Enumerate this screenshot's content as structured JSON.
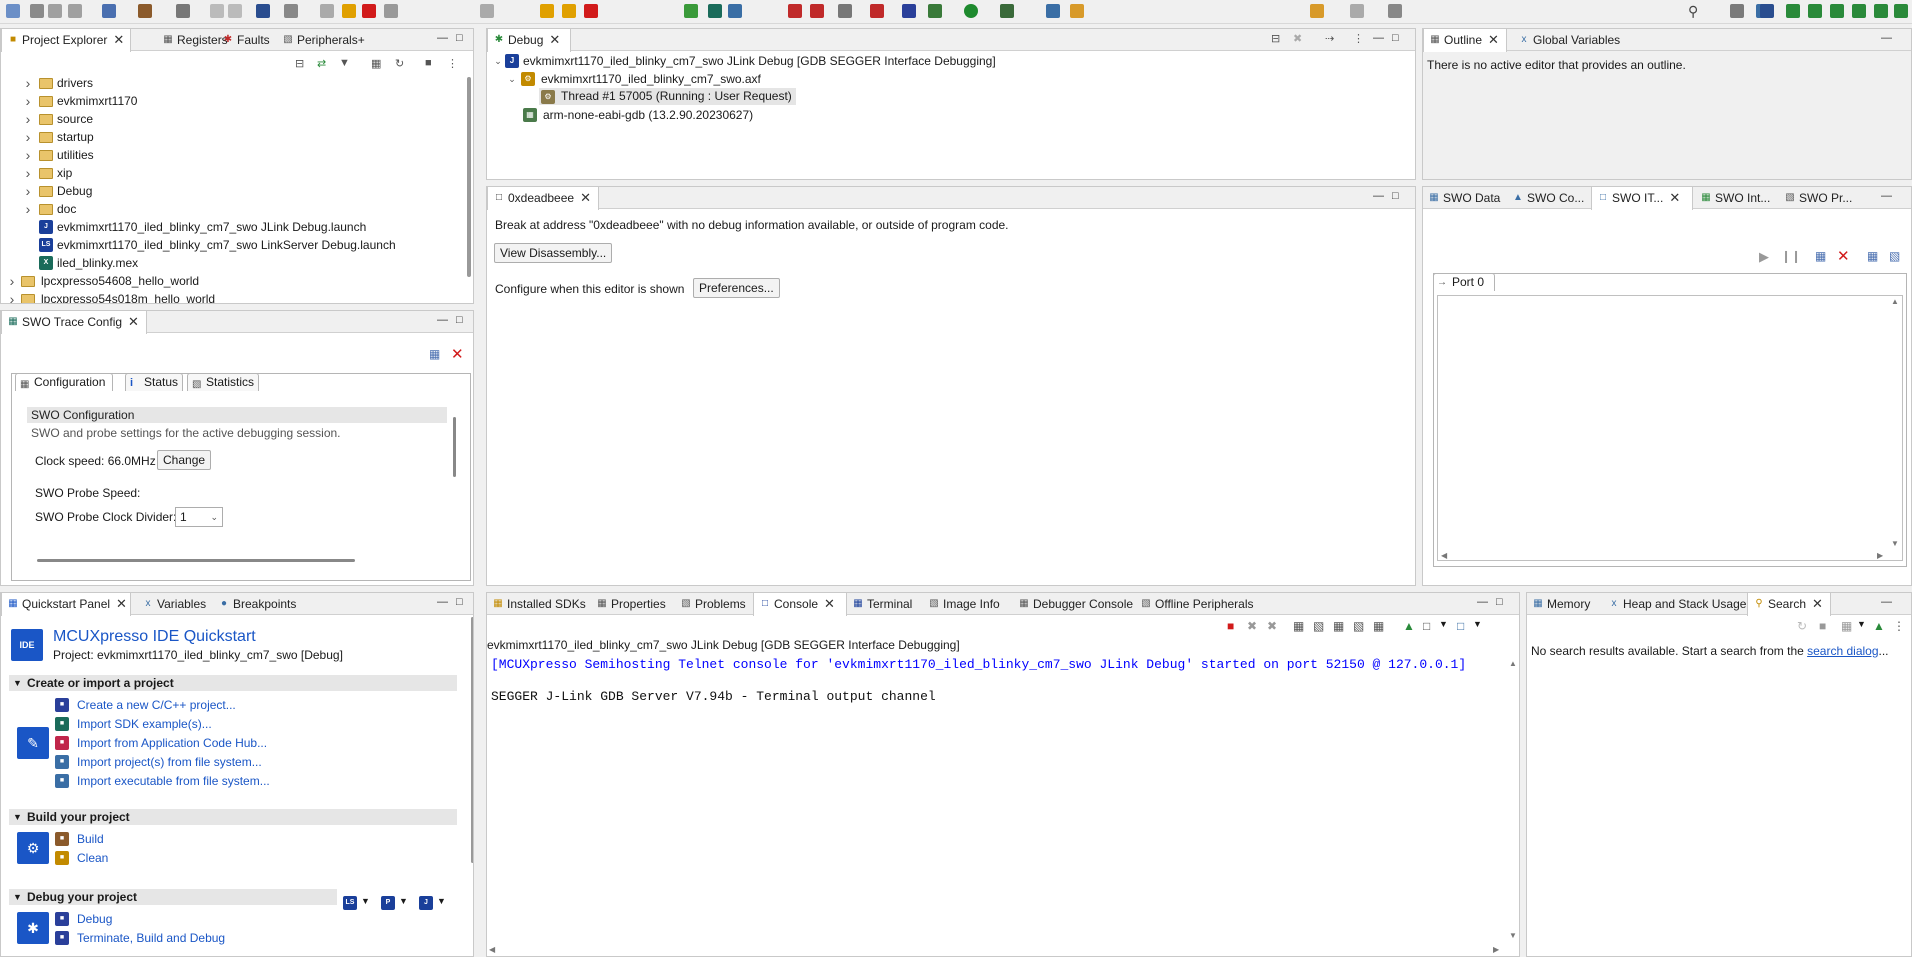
{
  "colors": {
    "accent": "#1155cc",
    "link": "#1a56c6",
    "console_blue": "#0000ff",
    "danger": "#d11a1a",
    "folder": "#e9c46a"
  },
  "project_explorer": {
    "tabs": [
      "Project Explorer",
      "Registers",
      "Faults",
      "Peripherals+"
    ],
    "items": [
      {
        "label": "drivers",
        "type": "folder"
      },
      {
        "label": "evkmimxrt1170",
        "type": "folder"
      },
      {
        "label": "source",
        "type": "folder"
      },
      {
        "label": "startup",
        "type": "folder"
      },
      {
        "label": "utilities",
        "type": "folder"
      },
      {
        "label": "xip",
        "type": "folder"
      },
      {
        "label": "Debug",
        "type": "folder"
      },
      {
        "label": "doc",
        "type": "folder"
      },
      {
        "label": "evkmimxrt1170_iled_blinky_cm7_swo JLink Debug.launch",
        "type": "jlink"
      },
      {
        "label": "evkmimxrt1170_iled_blinky_cm7_swo LinkServer Debug.launch",
        "type": "ls"
      },
      {
        "label": "iled_blinky.mex",
        "type": "mex"
      },
      {
        "label": "lpcxpresso54608_hello_world",
        "type": "project"
      },
      {
        "label": "lpcxpresso54s018m_hello_world",
        "type": "project"
      }
    ]
  },
  "swo_trace": {
    "tab": "SWO Trace Config",
    "subtabs": [
      "Configuration",
      "Status",
      "Statistics"
    ],
    "section_title": "SWO Configuration",
    "section_desc": "SWO and probe settings for the active debugging session.",
    "clock_speed_label": "Clock speed: 66.0MHz",
    "change_button": "Change",
    "probe_speed_label": "SWO Probe Speed:",
    "divider_label": "SWO Probe Clock Divider:",
    "divider_value": "1"
  },
  "debug_view": {
    "tab": "Debug",
    "launch": "evkmimxrt1170_iled_blinky_cm7_swo JLink Debug [GDB SEGGER Interface Debugging]",
    "axf": "evkmimxrt1170_iled_blinky_cm7_swo.axf",
    "thread": "Thread #1 57005 (Running : User Request)",
    "gdb": "arm-none-eabi-gdb (13.2.90.20230627)"
  },
  "editor": {
    "tab": "0xdeadbeee",
    "message": "Break at address \"0xdeadbeee\" with no debug information available, or outside of program code.",
    "view_disasm_button": "View Disassembly...",
    "configure_label": "Configure when this editor is shown",
    "preferences_button": "Preferences..."
  },
  "outline": {
    "tabs": [
      "Outline",
      "Global Variables"
    ],
    "message": "There is no active editor that provides an outline."
  },
  "swo_panel": {
    "tabs": [
      "SWO Data",
      "SWO Co...",
      "SWO IT...",
      "SWO Int...",
      "SWO Pr..."
    ],
    "port_tab": "Port 0"
  },
  "quickstart": {
    "tabs": [
      "Quickstart Panel",
      "Variables",
      "Breakpoints"
    ],
    "title": "MCUXpresso IDE Quickstart",
    "project": "Project: evkmimxrt1170_iled_blinky_cm7_swo [Debug]",
    "sections": [
      {
        "title": "Create or import a project",
        "items": [
          "Create a new C/C++ project...",
          "Import SDK example(s)...",
          "Import from Application Code Hub...",
          "Import project(s) from file system...",
          "Import executable from file system..."
        ]
      },
      {
        "title": "Build your project",
        "items": [
          "Build",
          "Clean"
        ]
      },
      {
        "title": "Debug your project",
        "items": [
          "Debug",
          "Terminate, Build and Debug"
        ]
      }
    ]
  },
  "console": {
    "tabs": [
      "Installed SDKs",
      "Properties",
      "Problems",
      "Console",
      "Terminal",
      "Image Info",
      "Debugger Console",
      "Offline Peripherals"
    ],
    "header": "evkmimxrt1170_iled_blinky_cm7_swo JLink Debug [GDB SEGGER Interface Debugging]",
    "line1": "[MCUXpresso Semihosting Telnet console for 'evkmimxrt1170_iled_blinky_cm7_swo JLink Debug' started on port 52150 @ 127.0.0.1]",
    "line2": "SEGGER J-Link GDB Server V7.94b - Terminal output channel"
  },
  "search": {
    "tabs": [
      "Memory",
      "Heap and Stack Usage",
      "Search"
    ],
    "message": "No search results available. Start a search from the ",
    "link": "search dialog",
    "suffix": "..."
  }
}
